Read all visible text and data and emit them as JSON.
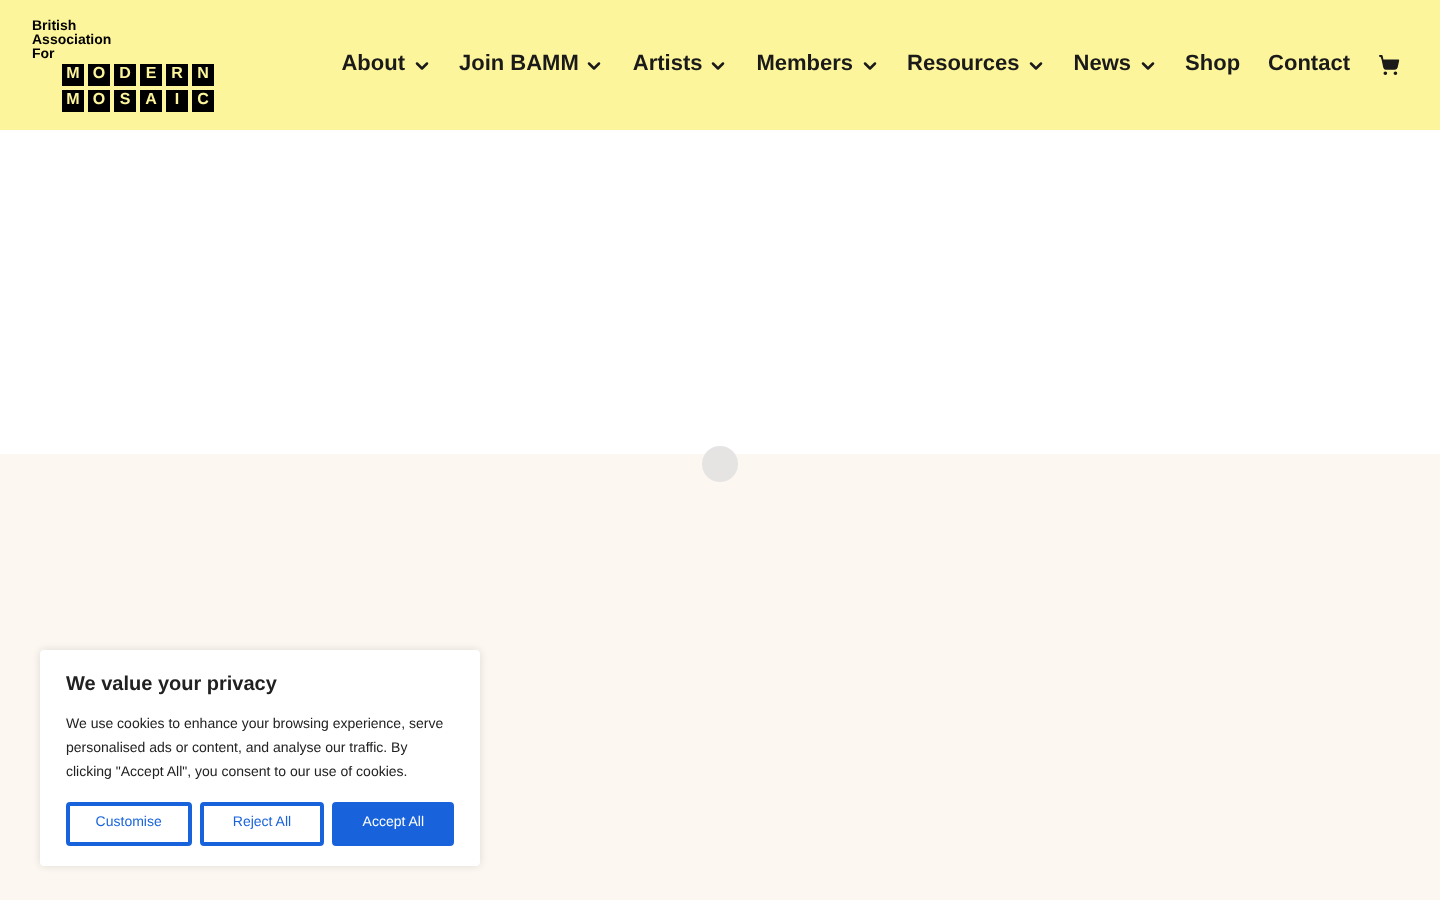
{
  "logo": {
    "tagline": [
      "British",
      "Association",
      "For"
    ],
    "tile_rows": [
      [
        "M",
        "O",
        "D",
        "E",
        "R",
        "N"
      ],
      [
        "M",
        "O",
        "S",
        "A",
        "I",
        "C"
      ]
    ]
  },
  "nav": [
    {
      "label": "About",
      "dropdown": true
    },
    {
      "label": "Join BAMM",
      "dropdown": true
    },
    {
      "label": "Artists",
      "dropdown": true
    },
    {
      "label": "Members",
      "dropdown": true
    },
    {
      "label": "Resources",
      "dropdown": true
    },
    {
      "label": "News",
      "dropdown": true
    },
    {
      "label": "Shop",
      "dropdown": false
    },
    {
      "label": "Contact",
      "dropdown": false
    }
  ],
  "cookie_banner": {
    "title": "We value your privacy",
    "body": "We use cookies to enhance your browsing experience, serve personalised ads or content, and analyse our traffic. By clicking \"Accept All\", you consent to our use of cookies.",
    "buttons": [
      {
        "label": "Customise",
        "kind": "outline"
      },
      {
        "label": "Reject All",
        "kind": "outline"
      },
      {
        "label": "Accept All",
        "kind": "primary"
      }
    ]
  }
}
